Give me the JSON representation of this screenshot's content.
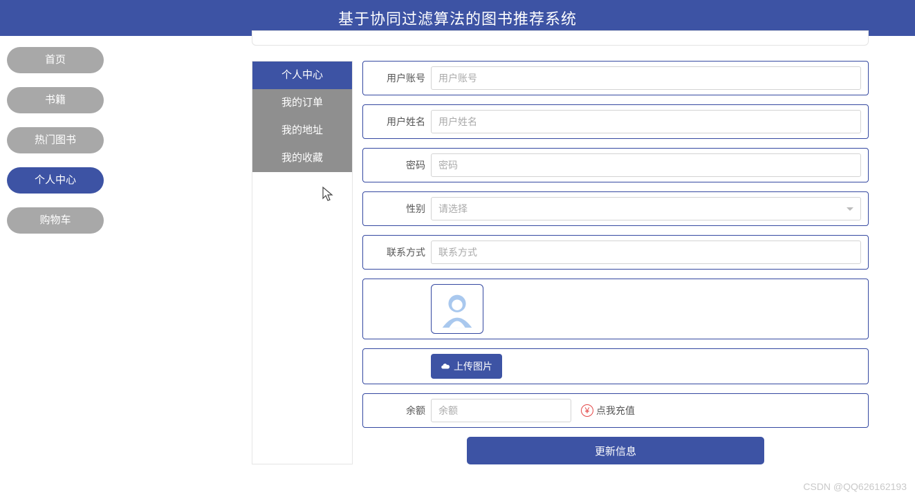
{
  "header": {
    "title": "基于协同过滤算法的图书推荐系统"
  },
  "crumb": "…",
  "leftNav": [
    {
      "label": "首页",
      "active": false
    },
    {
      "label": "书籍",
      "active": false
    },
    {
      "label": "热门图书",
      "active": false
    },
    {
      "label": "个人中心",
      "active": true
    },
    {
      "label": "购物车",
      "active": false
    }
  ],
  "subMenu": [
    {
      "label": "个人中心",
      "active": true
    },
    {
      "label": "我的订单",
      "active": false
    },
    {
      "label": "我的地址",
      "active": false
    },
    {
      "label": "我的收藏",
      "active": false
    }
  ],
  "form": {
    "account": {
      "label": "用户账号",
      "placeholder": "用户账号",
      "value": ""
    },
    "name": {
      "label": "用户姓名",
      "placeholder": "用户姓名",
      "value": ""
    },
    "password": {
      "label": "密码",
      "placeholder": "密码",
      "value": ""
    },
    "gender": {
      "label": "性别",
      "placeholder": "请选择",
      "value": ""
    },
    "contact": {
      "label": "联系方式",
      "placeholder": "联系方式",
      "value": ""
    },
    "upload": {
      "label": "上传图片"
    },
    "balance": {
      "label": "余额",
      "placeholder": "余额",
      "value": "",
      "recharge": "点我充值",
      "currency": "¥"
    },
    "submit": "更新信息"
  },
  "watermark": "CSDN @QQ626162193"
}
